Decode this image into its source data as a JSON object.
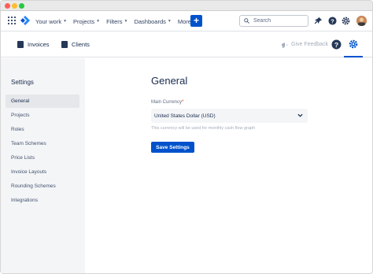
{
  "topnav": {
    "menu": [
      {
        "label": "Your work"
      },
      {
        "label": "Projects"
      },
      {
        "label": "Filters"
      },
      {
        "label": "Dashboards"
      },
      {
        "label": "More"
      }
    ],
    "create_label": "+",
    "search_placeholder": "Search"
  },
  "subnav": {
    "invoices_label": "Invoices",
    "clients_label": "Clients",
    "feedback_label": "Give Feedback"
  },
  "sidebar": {
    "title": "Settings",
    "items": [
      {
        "label": "General",
        "active": true
      },
      {
        "label": "Projects"
      },
      {
        "label": "Roles"
      },
      {
        "label": "Team Schemes"
      },
      {
        "label": "Price Lists"
      },
      {
        "label": "Invoice Layouts"
      },
      {
        "label": "Rounding Schemes"
      },
      {
        "label": "Integrations"
      }
    ]
  },
  "main": {
    "title": "General",
    "currency_label": "Main Currency",
    "required_mark": "*",
    "currency_value": "United States Dollar (USD)",
    "helper_text": "This currency will be used for monthly cash flow graph",
    "save_label": "Save Settings"
  },
  "colors": {
    "primary": "#0052cc",
    "sidebar_bg": "#f4f5f7",
    "text": "#172b4d"
  }
}
